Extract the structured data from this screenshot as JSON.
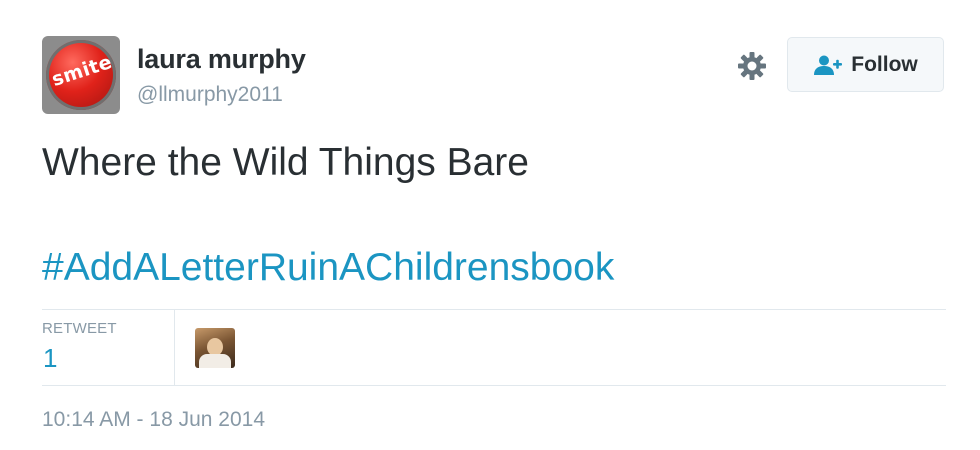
{
  "user": {
    "display_name": "laura murphy",
    "handle": "@llmurphy2011",
    "avatar_text": "smite"
  },
  "actions": {
    "follow_label": "Follow"
  },
  "tweet": {
    "text": "Where the Wild Things Bare",
    "hashtag": "#AddALetterRuinAChildrensbook"
  },
  "stats": {
    "retweet_label": "RETWEET",
    "retweet_count": "1"
  },
  "meta": {
    "timestamp": "10:14 AM - 18 Jun 2014"
  },
  "icons": {
    "settings": "gear-icon",
    "follow": "add-user-icon"
  },
  "colors": {
    "text": "#292f33",
    "muted": "#8899a6",
    "link": "#1b95c2",
    "border": "#e1e8ed",
    "button_bg": "#f5f8fa"
  }
}
